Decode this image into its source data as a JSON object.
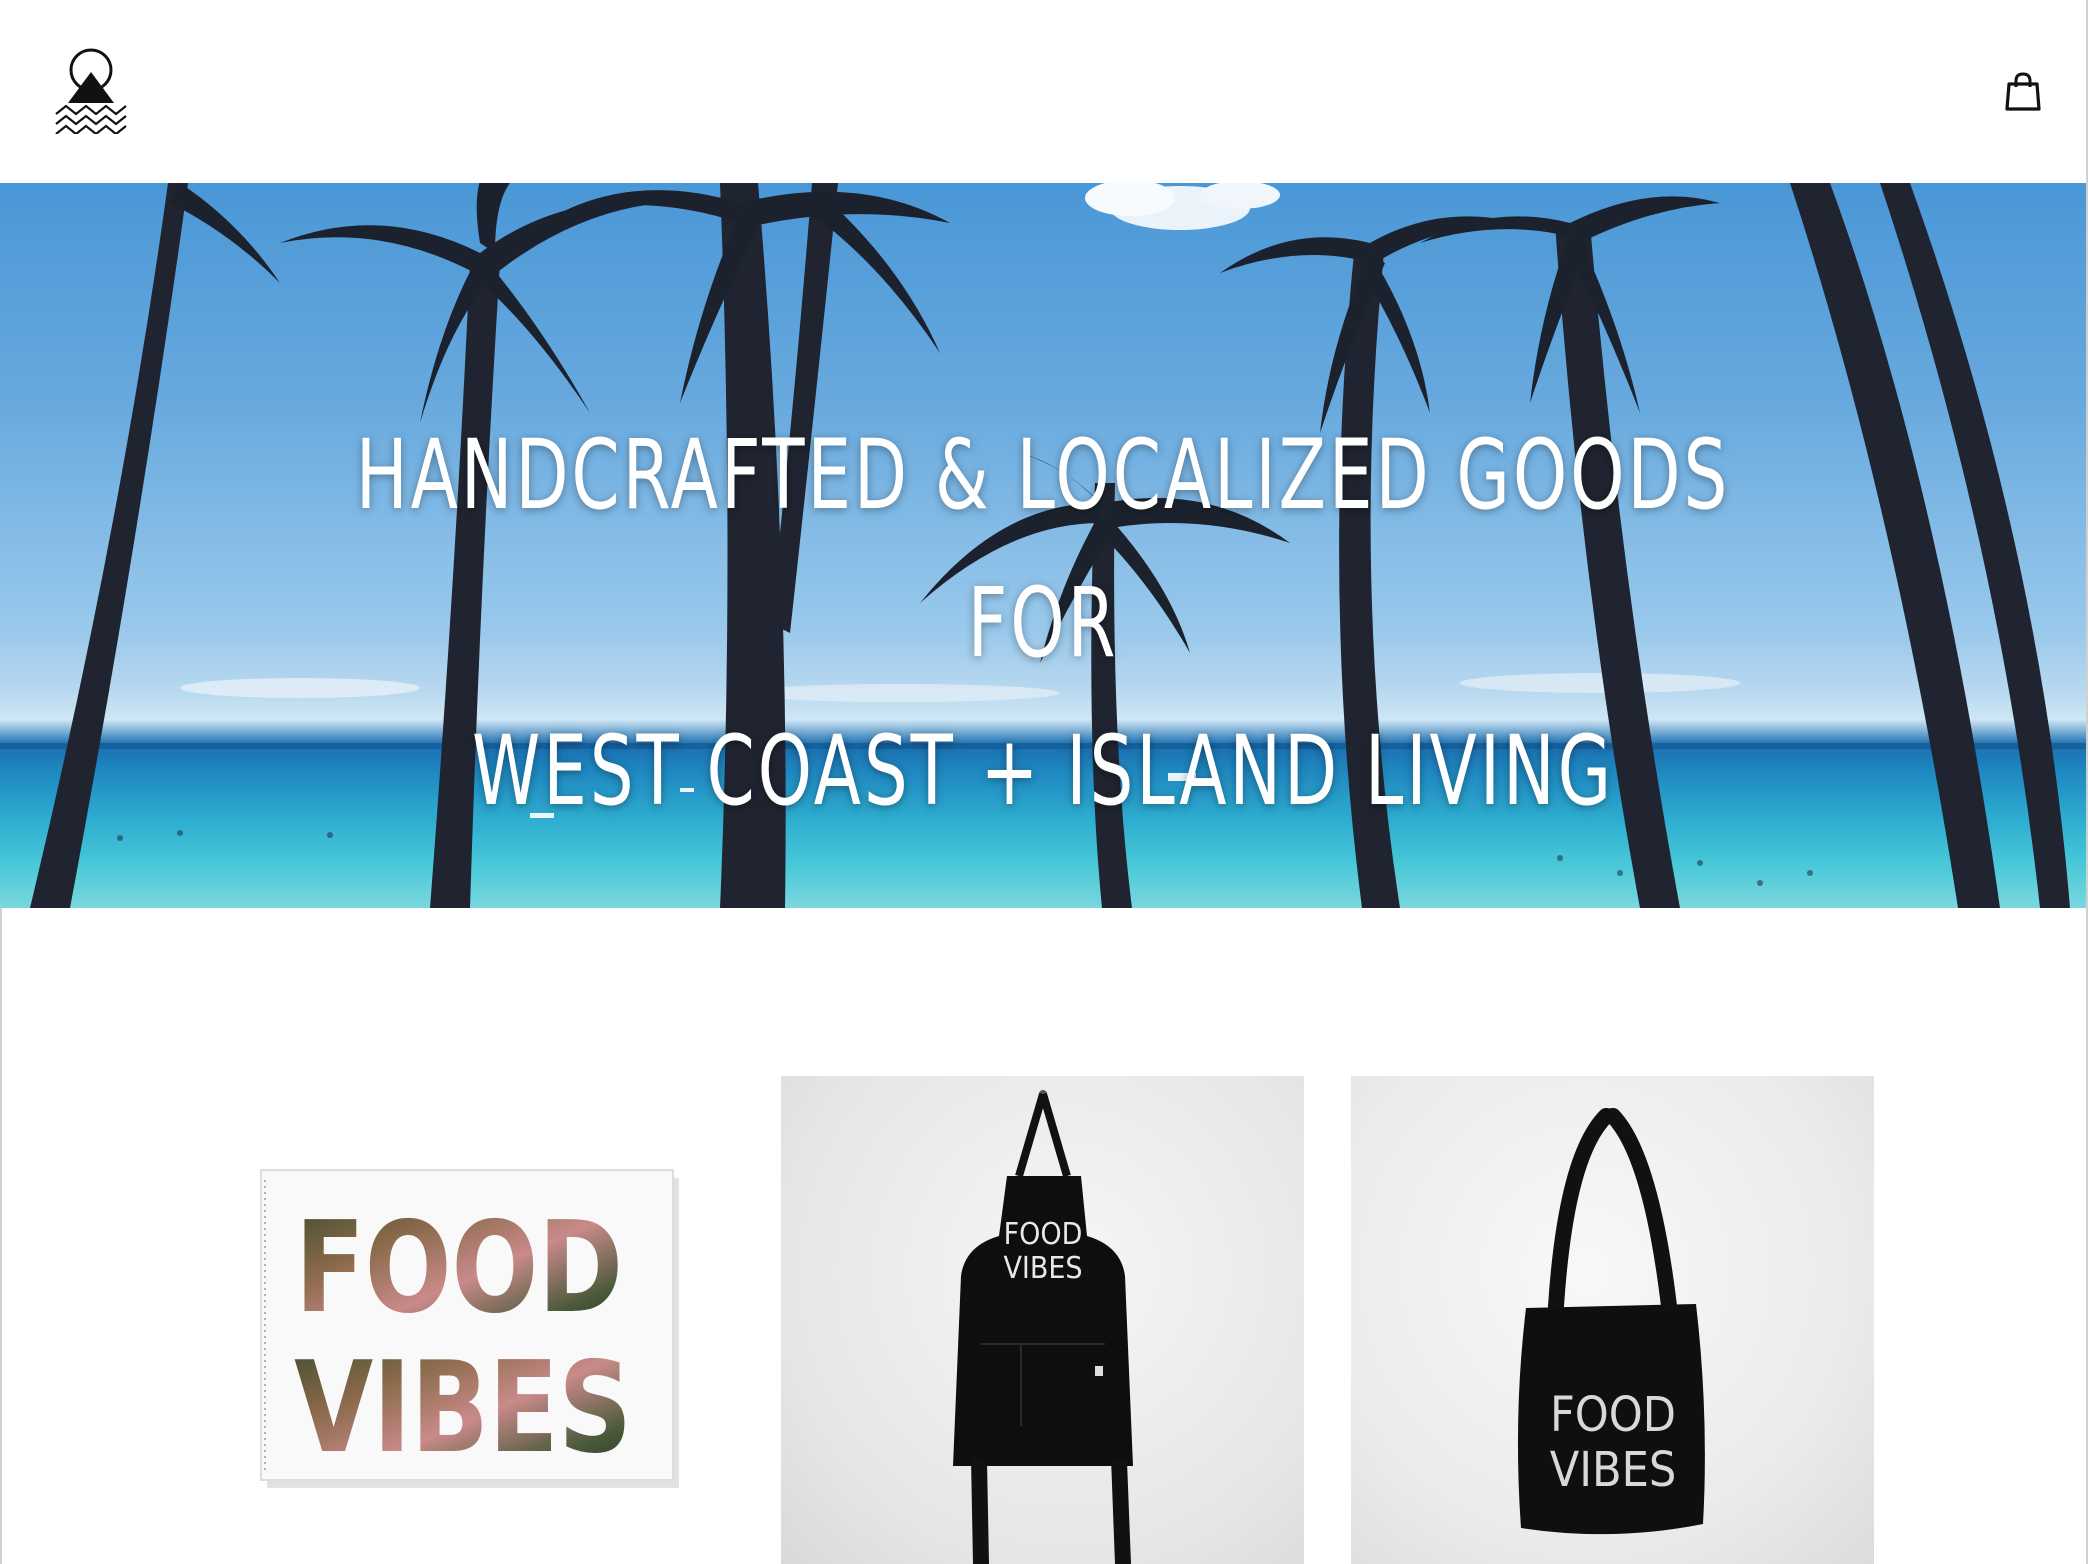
{
  "header": {
    "logo_icon": "sun-mountain-waves-logo",
    "cart_icon": "shopping-bag-icon"
  },
  "hero": {
    "title_line1": "HANDCRAFTED & LOCALIZED GOODS FOR",
    "title_line2": "WEST COAST + ISLAND LIVING"
  },
  "products": [
    {
      "image_text_line1": "FOOD",
      "image_text_line2": "VIBES"
    },
    {
      "image_text_line1": "FOOD",
      "image_text_line2": "VIBES"
    },
    {
      "image_text_line1": "FOOD",
      "image_text_line2": "VIBES"
    }
  ],
  "colors": {
    "sky": "#4a97d6",
    "ocean": "#2eaed0",
    "palm": "#1f2430",
    "text": "#ffffff",
    "ink": "#111111"
  }
}
